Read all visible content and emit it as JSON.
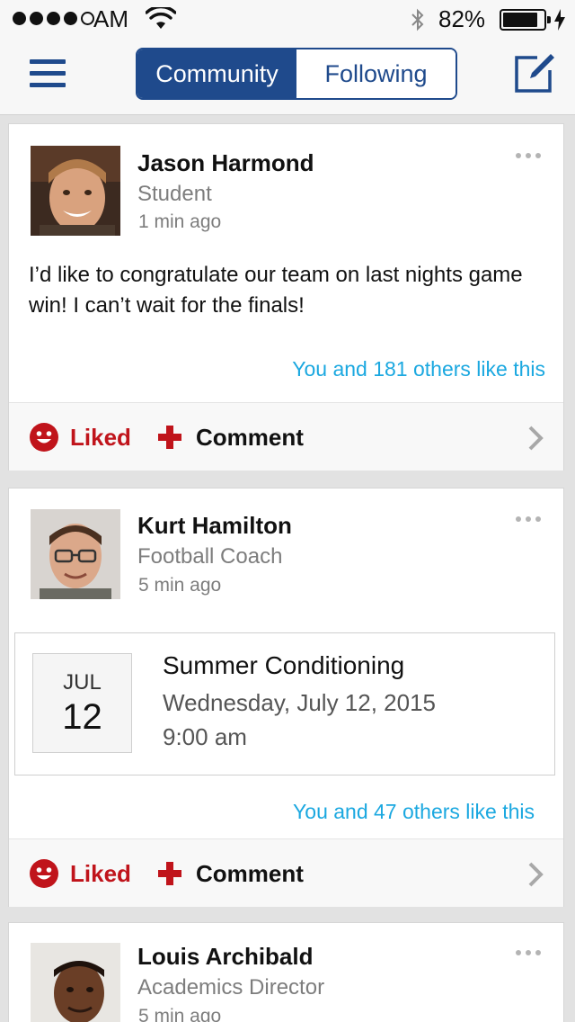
{
  "status_bar": {
    "carrier": "AM",
    "battery_percent": "82%",
    "battery_level": 0.82
  },
  "nav": {
    "tabs": [
      {
        "label": "Community",
        "active": true
      },
      {
        "label": "Following",
        "active": false
      }
    ],
    "icons": [
      "hamburger-menu-icon",
      "compose-icon"
    ],
    "accent_color": "#1f4a8c"
  },
  "posts": [
    {
      "author": "Jason Harmond",
      "role": "Student",
      "time": "1 min ago",
      "text": "I’d like to congratulate our team on last nights game win! I can’t wait for the finals!",
      "likes": "You and 181 others like this",
      "liked_label": "Liked",
      "comment_label": "Comment"
    },
    {
      "author": "Kurt Hamilton",
      "role": "Football Coach",
      "time": "5 min ago",
      "event": {
        "month": "JUL",
        "day": "12",
        "title": "Summer Conditioning",
        "date": "Wednesday, July 12, 2015",
        "time": "9:00 am"
      },
      "likes": "You and 47 others like this",
      "liked_label": "Liked",
      "comment_label": "Comment"
    },
    {
      "author": "Louis Archibald",
      "role": "Academics Director",
      "time": "5 min ago"
    }
  ],
  "colors": {
    "liked": "#c0141b",
    "likes_link": "#1ba8e0"
  }
}
